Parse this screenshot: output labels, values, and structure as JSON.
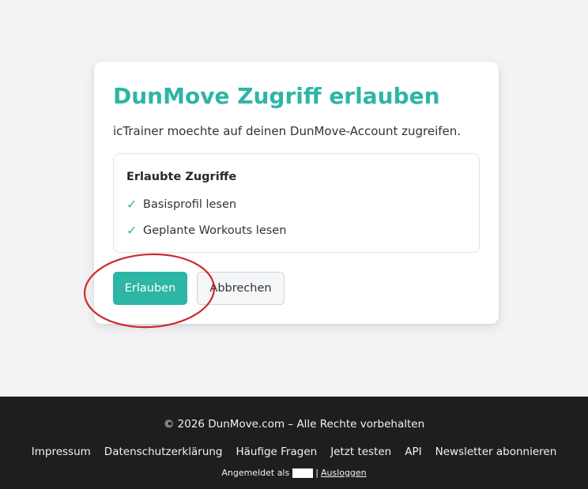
{
  "card": {
    "title": "DunMove Zugriff erlauben",
    "description": "icTrainer moechte auf deinen DunMove-Account zugreifen.",
    "permissions_heading": "Erlaubte Zugriffe",
    "permissions": [
      {
        "icon": "check-icon",
        "label": "Basisprofil lesen"
      },
      {
        "icon": "check-icon",
        "label": "Geplante Workouts lesen"
      }
    ],
    "allow_label": "Erlauben",
    "cancel_label": "Abbrechen"
  },
  "footer": {
    "copyright": "© 2026 DunMove.com – Alle Rechte vorbehalten",
    "links": [
      "Impressum",
      "Datenschutzerklärung",
      "Häufige Fragen",
      "Jetzt testen",
      "API",
      "Newsletter abonnieren"
    ],
    "logged_in_prefix": "Angemeldet als",
    "separator": "|",
    "logout_label": "Ausloggen"
  },
  "colors": {
    "accent": "#2db5a5",
    "footer_bg": "#1e1e20",
    "page_bg": "#f3f3f5",
    "highlight_ring": "#cc2b2b"
  }
}
